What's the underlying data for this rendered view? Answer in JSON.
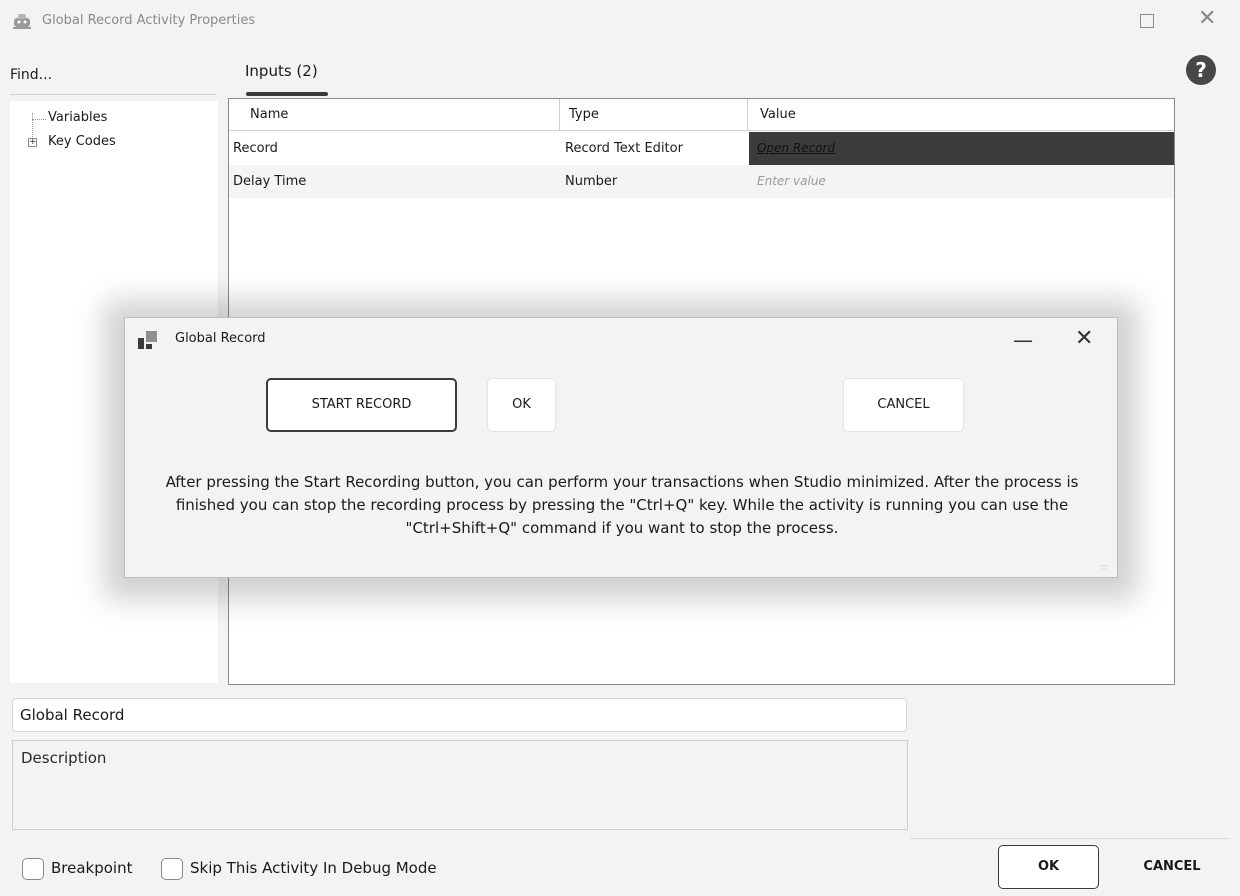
{
  "window": {
    "title": "Global Record Activity Properties",
    "app_icon": "robot-icon",
    "maximize_icon": "maximize-icon",
    "close_icon": "close-icon"
  },
  "help": {
    "icon": "help-icon",
    "label": "?"
  },
  "find": {
    "label": "Find..."
  },
  "tree": {
    "items": [
      {
        "label": "Variables"
      },
      {
        "label": "Key Codes",
        "expand_glyph": "+"
      }
    ]
  },
  "tabs": [
    {
      "label": "Inputs (2)"
    }
  ],
  "grid": {
    "columns": [
      "Name",
      "Type",
      "Value"
    ],
    "rows": [
      {
        "name": "Record",
        "type": "Record Text Editor",
        "value": "Open Record"
      },
      {
        "name": "Delay Time",
        "type": "Number",
        "value_placeholder": "Enter value"
      }
    ]
  },
  "modal": {
    "title": "Global Record",
    "minimize_glyph": "—",
    "close_glyph": "✕",
    "start_label": "START RECORD",
    "ok_label": "OK",
    "cancel_label": "CANCEL",
    "message": "After pressing the Start Recording button, you can perform your transactions when Studio minimized. After the process is finished you can stop the recording process by pressing the \"Ctrl+Q\"  key. While the activity is running you can use the \"Ctrl+Shift+Q\" command if you want to stop the process.",
    "grip_glyph": "::"
  },
  "activity_name": {
    "value": "Global Record"
  },
  "description": {
    "placeholder": "Description"
  },
  "options": {
    "breakpoint_label": "Breakpoint",
    "skip_label": "Skip This Activity In Debug Mode"
  },
  "footer": {
    "ok_label": "OK",
    "cancel_label": "CANCEL"
  },
  "colors": {
    "dark_cell": "#3b3b3b",
    "help_bg": "#474747"
  }
}
